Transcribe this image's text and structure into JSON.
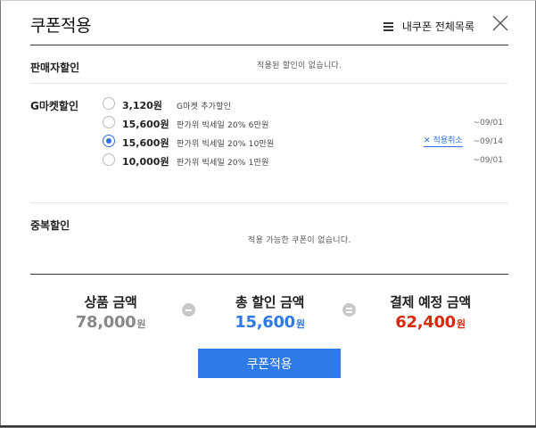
{
  "header": {
    "title": "쿠폰적용",
    "all_coupons_label": "내쿠폰 전체목록"
  },
  "seller_discount": {
    "title": "판매자할인",
    "empty_message": "적용된 할인이 없습니다."
  },
  "gmarket_discount": {
    "title": "G마켓할인",
    "options": [
      {
        "amount": "3,120원",
        "description": "G마켓 추가할인",
        "expiry": "",
        "selected": false
      },
      {
        "amount": "15,600원",
        "description": "판가위 빅세일 20% 6만원",
        "expiry": "~09/01",
        "selected": false
      },
      {
        "amount": "15,600원",
        "description": "판가위 빅세일 20% 10만원",
        "expiry": "~09/14",
        "selected": true
      },
      {
        "amount": "10,000원",
        "description": "판가위 빅세일 20% 1만원",
        "expiry": "~09/01",
        "selected": false
      }
    ],
    "cancel_label": "적용취소"
  },
  "duplicate_discount": {
    "title": "중복할인",
    "empty_message": "적용 가능한 쿠폰이 없습니다."
  },
  "summary": {
    "product_label": "상품 금액",
    "product_value": "78,000",
    "discount_label": "총 할인 금액",
    "discount_value": "15,600",
    "payment_label": "결제 예정 금액",
    "payment_value": "62,400",
    "unit": "원",
    "colors": {
      "product": "#888888",
      "discount": "#2f7ae6",
      "payment": "#d8290e"
    }
  },
  "apply_button_label": "쿠폰적용"
}
